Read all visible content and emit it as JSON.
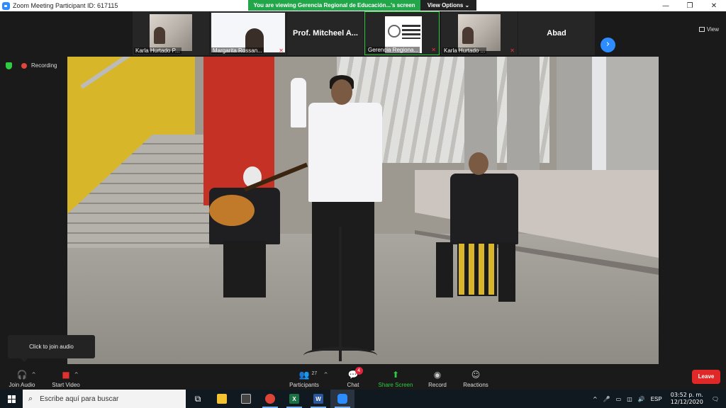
{
  "window": {
    "title": "Zoom Meeting Participant ID: 617115",
    "controls": {
      "minimize": "—",
      "restore": "❐",
      "close": "✕"
    }
  },
  "share_banner": {
    "message": "You are viewing Gerencia Regional de Educación...'s screen",
    "view_options": "View Options ⌄"
  },
  "thumbnails": [
    {
      "name": "Karla Hurtado P..."
    },
    {
      "name": "Margarita Rossan..."
    },
    {
      "name": "Prof. Mitcheel A..."
    },
    {
      "name": "Gerencia Regiona..."
    },
    {
      "name": "Karla Hurtado ..."
    },
    {
      "name": "Abad"
    }
  ],
  "view_button": "View",
  "recording_label": "Recording",
  "tooltip": "Click to join audio",
  "toolbar": {
    "join_audio": "Join Audio",
    "start_video": "Start Video",
    "participants": "Participants",
    "participants_count": "27",
    "chat": "Chat",
    "chat_badge": "4",
    "share_screen": "Share Screen",
    "record": "Record",
    "reactions": "Reactions",
    "leave": "Leave"
  },
  "taskbar": {
    "search_placeholder": "Escribe aquí para buscar",
    "language": "ESP",
    "time": "03:52 p. m.",
    "date": "12/12/2020"
  },
  "colors": {
    "zoom_blue": "#2d8cff",
    "share_green": "#22a64a",
    "leave_red": "#e02828"
  }
}
